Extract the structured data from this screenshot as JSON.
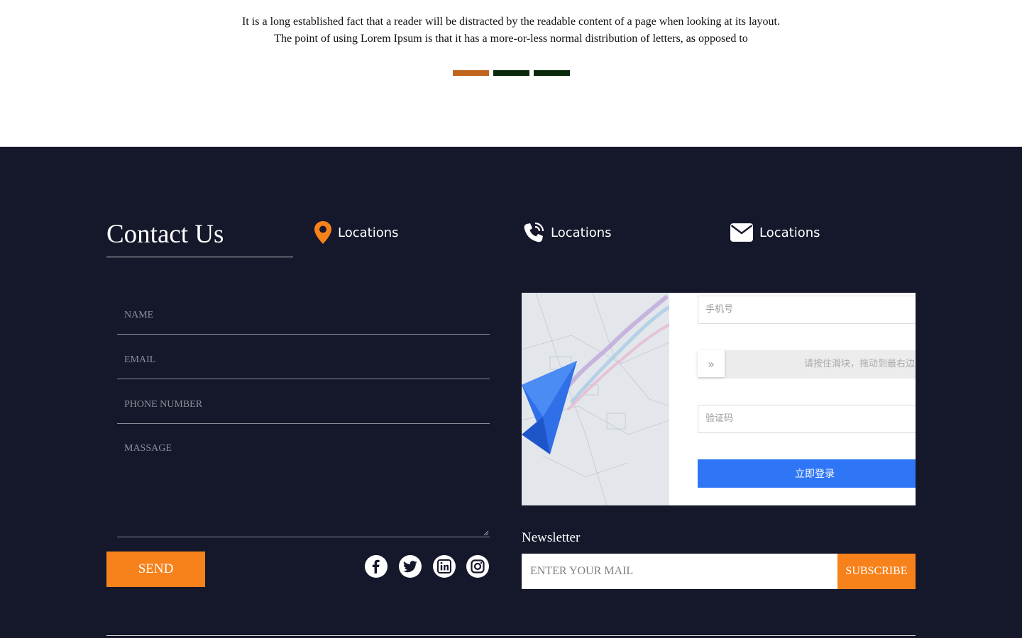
{
  "intro": {
    "line1": "It is a long established fact that a reader will be distracted by the readable content of a page when looking at its layout.",
    "line2": "The point of using Lorem Ipsum is that it has a more-or-less normal distribution of letters, as opposed to"
  },
  "indicators": [
    {
      "color": "#c0641e",
      "active": true
    },
    {
      "color": "#0b2a0c",
      "active": false
    },
    {
      "color": "#0b2a0c",
      "active": false
    }
  ],
  "contact": {
    "title": "Contact Us",
    "locations": [
      {
        "label": "Locations",
        "icon": "map-pin-icon"
      },
      {
        "label": "Locations",
        "icon": "phone-icon"
      },
      {
        "label": "Locations",
        "icon": "envelope-icon"
      }
    ],
    "form": {
      "name_placeholder": "NAME",
      "email_placeholder": "EMAIL",
      "phone_placeholder": "PHONE NUMBER",
      "message_placeholder": "MASSAGE",
      "send_label": "SEND"
    },
    "social": [
      "facebook-icon",
      "twitter-icon",
      "linkedin-icon",
      "instagram-icon"
    ]
  },
  "captcha": {
    "phone_placeholder": "手机号",
    "slider_text": "请按住滑块，拖动到最右边",
    "code_placeholder": "验证码",
    "login_label": "立即登录"
  },
  "newsletter": {
    "title": "Newsletter",
    "placeholder": "ENTER YOUR MAIL",
    "button_label": "SUBSCRIBE"
  },
  "colors": {
    "footer_bg": "#15182b",
    "accent": "#f7811b",
    "login_blue": "#2f76f7"
  }
}
